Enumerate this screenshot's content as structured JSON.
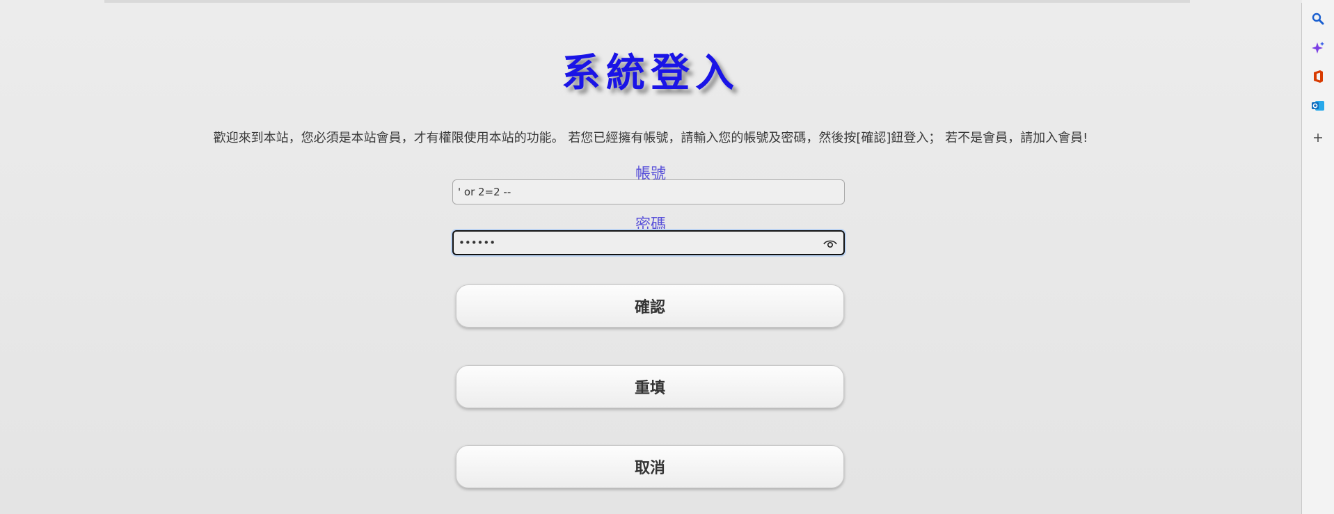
{
  "page": {
    "title": "系統登入",
    "welcome": "歡迎來到本站，您必須是本站會員，才有權限使用本站的功能。 若您已經擁有帳號，請輸入您的帳號及密碼，然後按[確認]鈕登入； 若不是會員，請加入會員!"
  },
  "form": {
    "account_label": "帳號",
    "account_value": "' or 2=2 --",
    "password_label": "密碼",
    "password_value": "••••••"
  },
  "buttons": {
    "confirm": "確認",
    "reset": "重填",
    "cancel": "取消"
  },
  "sidebar": {
    "icons": [
      "search-icon",
      "copilot-sparkle-icon",
      "office-icon",
      "outlook-icon",
      "plus-icon"
    ],
    "colors": {
      "search": "#1a5fd0",
      "copilot": "#7b3fe4",
      "office": "#d83b01",
      "outlook": "#0f6cbd"
    }
  },
  "colors": {
    "title": "#1a14e6",
    "label": "#5a52d9"
  }
}
